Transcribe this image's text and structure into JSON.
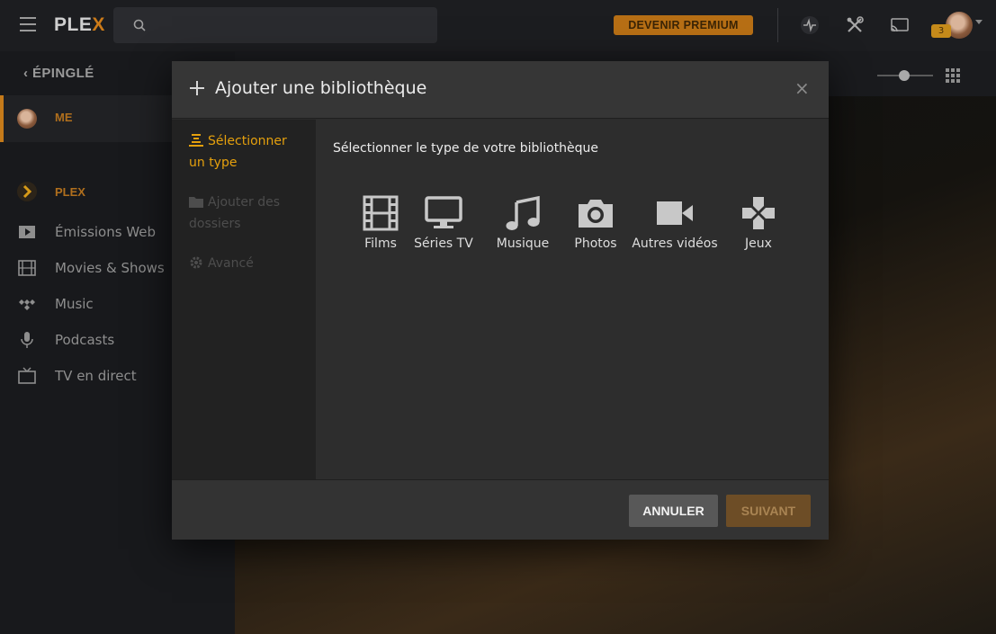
{
  "topbar": {
    "logo_prefix": "PLE",
    "logo_accent": "X",
    "search": {
      "value": "",
      "placeholder": ""
    },
    "premium_label": "DEVENIR PREMIUM",
    "notification_count": "3",
    "icons": [
      "activity-icon",
      "settings-tools-icon",
      "cast-icon"
    ]
  },
  "sidebar": {
    "back_label": "ÉPINGLÉ",
    "me_label": "ME",
    "plex_label": "PLEX",
    "items": [
      {
        "label": "Émissions Web",
        "icon": "play-box-icon"
      },
      {
        "label": "Movies & Shows",
        "icon": "film-icon"
      },
      {
        "label": "Music",
        "icon": "music-tidal-icon"
      },
      {
        "label": "Podcasts",
        "icon": "microphone-icon"
      },
      {
        "label": "TV en direct",
        "icon": "tv-icon"
      }
    ]
  },
  "modal": {
    "title": "Ajouter une bibliothèque",
    "close_glyph": "×",
    "steps": [
      {
        "label": "Sélectionner un type",
        "state": "active"
      },
      {
        "label": "Ajouter des dossiers",
        "state": "disabled"
      },
      {
        "label": "Avancé",
        "state": "disabled"
      }
    ],
    "pane_title": "Sélectionner le type de votre bibliothèque",
    "types": [
      {
        "label": "Films",
        "icon": "film-icon"
      },
      {
        "label": "Séries TV",
        "icon": "monitor-icon"
      },
      {
        "label": "Musique",
        "icon": "music-note-icon"
      },
      {
        "label": "Photos",
        "icon": "camera-icon"
      },
      {
        "label": "Autres vidéos",
        "icon": "video-camera-icon"
      },
      {
        "label": "Jeux",
        "icon": "gamepad-icon"
      }
    ],
    "cancel_label": "ANNULER",
    "next_label": "SUIVANT"
  },
  "colors": {
    "accent": "#e5a00d",
    "brand_orange": "#cc7b19",
    "modal_bg": "#2b2b2b",
    "page_bg": "#0f1114"
  }
}
